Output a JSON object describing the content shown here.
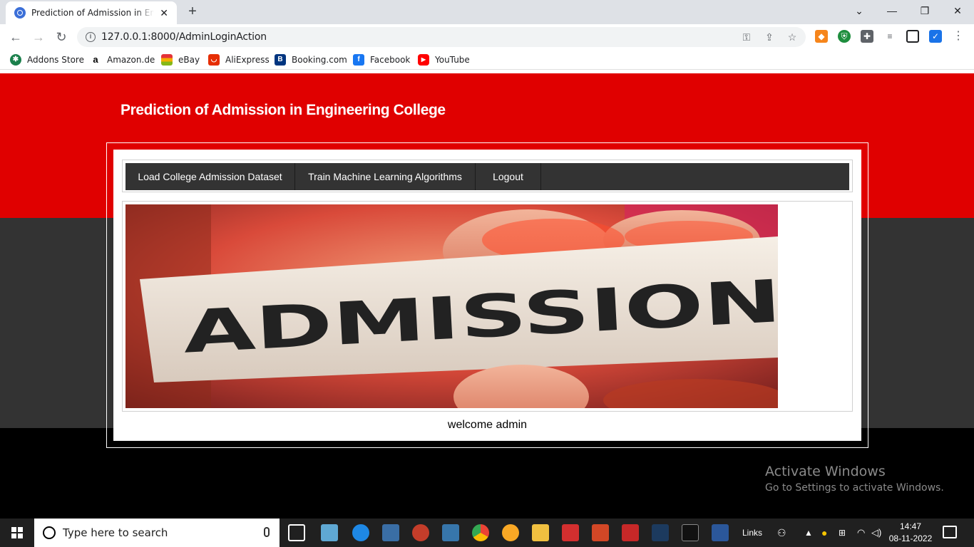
{
  "browser": {
    "tab_title": "Prediction of Admission in Engine",
    "tab_close": "✕",
    "new_tab": "+",
    "url": "127.0.0.1:8000/AdminLoginAction",
    "window_controls": {
      "dropdown": "⌄",
      "minimize": "—",
      "restore": "❐",
      "close": "✕"
    },
    "nav": {
      "back": "←",
      "forward": "→",
      "reload": "↻"
    }
  },
  "bookmarks": [
    {
      "label": "Addons Store",
      "icon": "addons-store-icon",
      "color": "#1a7f4b",
      "glyph": "✱"
    },
    {
      "label": "Amazon.de",
      "icon": "amazon-icon",
      "color": "#ffffff",
      "glyph": "a"
    },
    {
      "label": "eBay",
      "icon": "ebay-icon",
      "color": "#0064d2",
      "glyph": "▦"
    },
    {
      "label": "AliExpress",
      "icon": "aliexpress-icon",
      "color": "#e62e04",
      "glyph": "◡"
    },
    {
      "label": "Booking.com",
      "icon": "booking-icon",
      "color": "#003580",
      "glyph": "B"
    },
    {
      "label": "Facebook",
      "icon": "facebook-icon",
      "color": "#1877f2",
      "glyph": "f"
    },
    {
      "label": "YouTube",
      "icon": "youtube-icon",
      "color": "#ff0000",
      "glyph": "▶"
    }
  ],
  "page": {
    "site_title": "Prediction of Admission in Engineering College",
    "menu": [
      {
        "label": "Load College Admission Dataset"
      },
      {
        "label": "Train Machine Learning Algorithms"
      },
      {
        "label": "Logout"
      }
    ],
    "hero_word": "ADMISSION",
    "welcome": "welcome admin",
    "colors": {
      "header_red": "#e00000",
      "band_dark": "#333333",
      "menu_bg": "#333333"
    }
  },
  "watermark": {
    "line1": "Activate Windows",
    "line2": "Go to Settings to activate Windows."
  },
  "taskbar": {
    "search_placeholder": "Type here to search",
    "links_label": "Links",
    "time": "14:47",
    "date": "08-11-2022"
  }
}
